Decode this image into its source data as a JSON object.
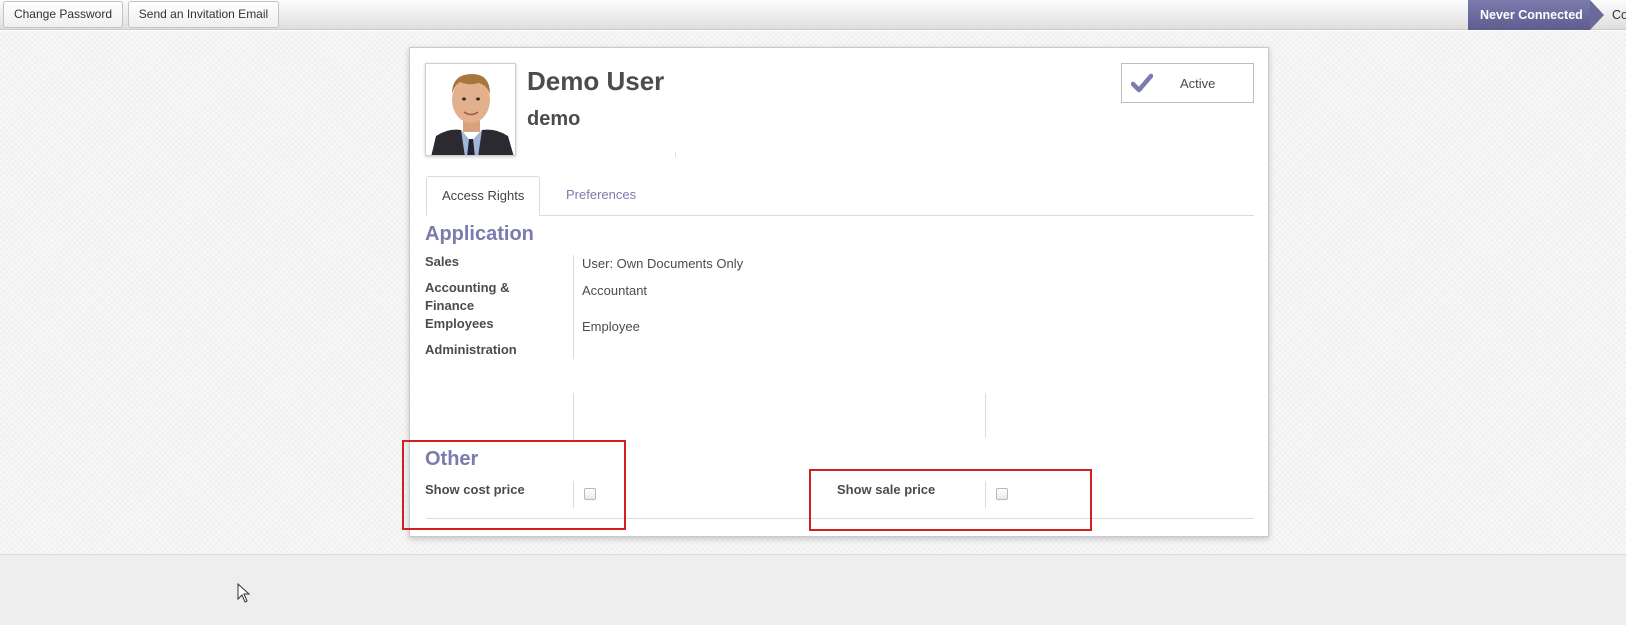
{
  "statusbar": {
    "change_password": "Change Password",
    "send_invitation": "Send an Invitation Email",
    "stage_current": "Never Connected",
    "stage_next": "Co"
  },
  "user": {
    "name": "Demo User",
    "login": "demo",
    "active_label": "Active"
  },
  "tabs": [
    {
      "label": "Access Rights",
      "active": true
    },
    {
      "label": "Preferences",
      "active": false
    }
  ],
  "application": {
    "title": "Application",
    "rows": [
      {
        "label": "Sales",
        "value": "User: Own Documents Only"
      },
      {
        "label": "Accounting & Finance",
        "value": "Accountant"
      },
      {
        "label": "Employees",
        "value": "Employee"
      },
      {
        "label": "Administration",
        "value": ""
      }
    ]
  },
  "other": {
    "title": "Other",
    "show_cost_price": {
      "label": "Show cost price",
      "checked": false
    },
    "show_sale_price": {
      "label": "Show sale price",
      "checked": false
    }
  },
  "colors": {
    "accent": "#7c7bad",
    "highlight": "#d31f1f"
  },
  "icons": {
    "active": "check-icon",
    "cursor": "mouse-pointer-icon"
  }
}
